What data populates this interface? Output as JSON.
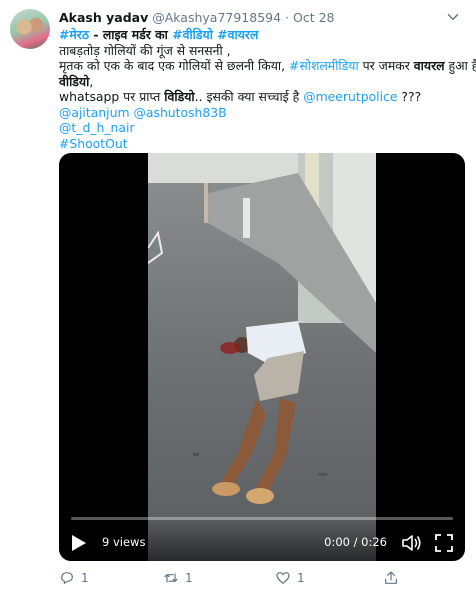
{
  "tweet": {
    "author_name": "Akash yadav",
    "author_handle": "@Akashya77918594",
    "separator": " · ",
    "date": "Oct 28",
    "line1_tag1": "#मेरठ",
    "line1_text": " - लाइव मर्डर का ",
    "line1_tag2": "#वीडियो",
    "line1_tag3": "#वायरल",
    "line2": " ताबड़तोड़ गोलियों की गूंज से सनसनी ,",
    "line3_text": "मृतक को एक के बाद एक गोलियों से छलनी किया, ",
    "line3_tag": "#सोशलमीडिया",
    "line3_text2": " पर जमकर ",
    "line3_bold": "वायरल",
    "line3_text3": " हुआ है",
    "line4_bold": "वीडियो",
    "line4_text": ",",
    "line5_text": "whatsapp पर प्राप्त ",
    "line5_bold": "विडियो",
    "line5_text2": ".. इसकी क्या सच्चाई है  ",
    "line5_mention": "@meerutpolice",
    "line5_text3": " ???",
    "line6_mention1": " @ajitanjum",
    "line6_mention2": "@ashutosh83B",
    "line7_mention": "@t_d_h_nair",
    "line8_tag": "#ShootOut"
  },
  "video": {
    "views": "9 views",
    "time": "0:00 / 0:26",
    "progress": 0
  },
  "actions": {
    "replies": "1",
    "retweets": "1",
    "likes": "1"
  },
  "colors": {
    "link": "#1da1f2",
    "muted": "#657786",
    "text": "#14171a"
  }
}
